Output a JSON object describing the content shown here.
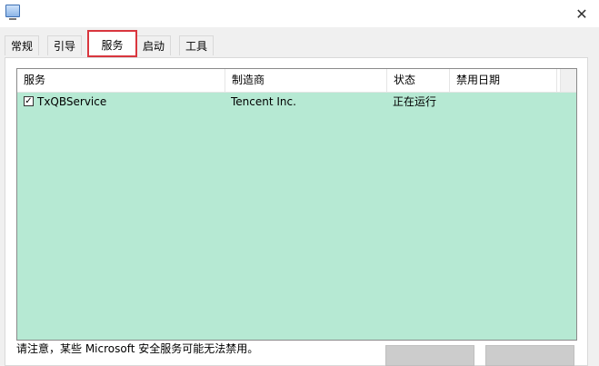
{
  "window": {
    "close_glyph": "✕"
  },
  "tabs": [
    {
      "label": "常规",
      "active": false
    },
    {
      "label": "引导",
      "active": false
    },
    {
      "label": "服务",
      "active": true
    },
    {
      "label": "启动",
      "active": false
    },
    {
      "label": "工具",
      "active": false
    }
  ],
  "services_list": {
    "columns": [
      "服务",
      "制造商",
      "状态",
      "禁用日期"
    ],
    "rows": [
      {
        "checked": true,
        "service": "TxQBService",
        "manufacturer": "Tencent Inc.",
        "status": "正在运行",
        "disabled_date": ""
      }
    ]
  },
  "note": "请注意，某些 Microsoft 安全服务可能无法禁用。",
  "colors": {
    "list_background": "#b6e9d3",
    "active_tab_highlight": "#d9363e"
  }
}
